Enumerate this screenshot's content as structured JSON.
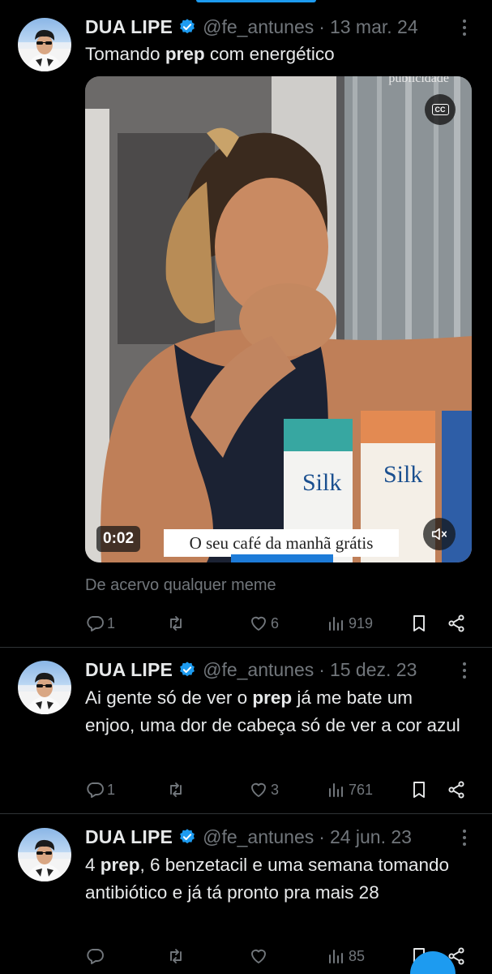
{
  "tweets": [
    {
      "display_name": "DUA LIPE",
      "handle": "@fe_antunes",
      "separator": "·",
      "date": "13 mar. 24",
      "text_before": "Tomando ",
      "text_bold": "prep",
      "text_after": " com energético",
      "media": {
        "publicidade": "publicidade",
        "cc_label": "CC",
        "timestamp": "0:02",
        "caption": "O seu café da manhã grátis"
      },
      "source": "De acervo qualquer meme",
      "replies": "1",
      "reposts": "",
      "likes": "6",
      "views": "919"
    },
    {
      "display_name": "DUA LIPE",
      "handle": "@fe_antunes",
      "separator": "·",
      "date": "15 dez. 23",
      "text_before": "Ai gente só de ver o ",
      "text_bold": "prep",
      "text_after": " já me bate um enjoo, uma dor de cabeça só de ver a cor azul",
      "replies": "1",
      "reposts": "",
      "likes": "3",
      "views": "761"
    },
    {
      "display_name": "DUA LIPE",
      "handle": "@fe_antunes",
      "separator": "·",
      "date": "24 jun. 23",
      "text_before": "4 ",
      "text_bold": "prep",
      "text_after": ", 6 benzetacil e uma semana tomando antibiótico e já tá pronto pra mais 28",
      "replies": "",
      "reposts": "",
      "likes": "",
      "views": "85"
    }
  ],
  "colors": {
    "background": "#000000",
    "text_primary": "#e7e9ea",
    "text_secondary": "#71767b",
    "accent": "#1d9bf0",
    "divider": "#2f3336"
  },
  "icons": [
    "reply-icon",
    "repost-icon",
    "like-icon",
    "views-icon",
    "bookmark-icon",
    "share-icon",
    "verified-badge-icon",
    "more-icon",
    "cc-icon",
    "mute-icon"
  ]
}
